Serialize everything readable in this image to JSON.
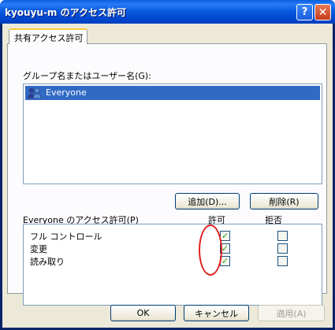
{
  "window": {
    "title": "kyouyu-m のアクセス許可",
    "help_glyph": "?",
    "close_glyph": "✕"
  },
  "tab": {
    "label": "共有アクセス許可"
  },
  "groups": {
    "label": "グループ名またはユーザー名(G):",
    "items": [
      {
        "name": "Everyone",
        "icon": "users-group-icon",
        "selected": true
      }
    ]
  },
  "buttons": {
    "add": "追加(D)...",
    "remove": "削除(R)",
    "ok": "OK",
    "cancel": "キャンセル",
    "apply": "適用(A)"
  },
  "permissions": {
    "label": "Everyone のアクセス許可(P)",
    "allow_header": "許可",
    "deny_header": "拒否",
    "rows": [
      {
        "name": "フル コントロール",
        "allow": true,
        "deny": false
      },
      {
        "name": "変更",
        "allow": true,
        "deny": false
      },
      {
        "name": "読み取り",
        "allow": true,
        "deny": false
      }
    ],
    "check_glyph": "✓"
  },
  "colors": {
    "titlebar": "#0054e3",
    "selection": "#316ac5",
    "annotation": "#e02020"
  }
}
